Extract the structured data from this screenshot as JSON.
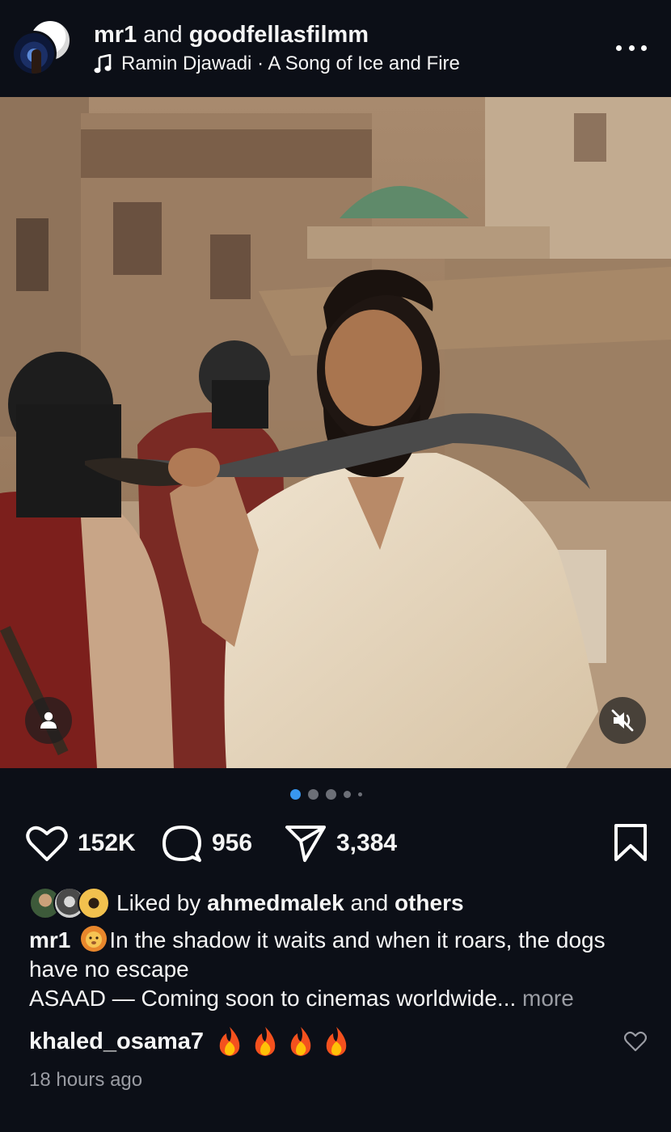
{
  "header": {
    "account_primary": "mr1",
    "connector": "and",
    "account_secondary": "goodfellasfilmm",
    "music_artist": "Ramin Djawadi",
    "music_separator": "·",
    "music_title": "A Song of Ice and Fire"
  },
  "carousel": {
    "count": 5,
    "active_index": 0
  },
  "actions": {
    "likes": "152K",
    "comments": "956",
    "shares": "3,384"
  },
  "likes_line": {
    "prefix": "Liked by",
    "user": "ahmedmalek",
    "connector": "and",
    "suffix": "others"
  },
  "caption": {
    "author": "mr1",
    "text": "In the shadow it waits and when it roars, the dogs have no escape",
    "line2": "ASAAD — Coming soon to cinemas worldwide...",
    "more": "more"
  },
  "comment": {
    "user": "khaled_osama7"
  },
  "timestamp": "18 hours ago",
  "colors": {
    "background": "#0c0f17",
    "active_dot": "#3897f0",
    "inactive_dot": "#6c6f77",
    "muted_text": "#9a9ca3"
  },
  "icons": [
    "more-icon",
    "music-note-icon",
    "tag-people-icon",
    "mute-icon",
    "heart-icon",
    "comment-icon",
    "share-icon",
    "bookmark-icon",
    "lion-emoji",
    "fire-emoji"
  ]
}
